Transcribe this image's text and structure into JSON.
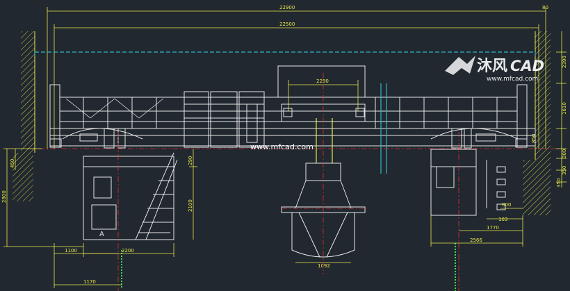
{
  "dimensions": {
    "span_outer": "22900",
    "span_inner": "22500",
    "right_top": "80",
    "trolley_gauge": "2290",
    "right_1": "2390",
    "right_2": "1610",
    "right_3": "850",
    "right_4": "300",
    "right_5": "350",
    "right_6": "350",
    "left_450": "450",
    "left_2800": "2800",
    "mid_290": "290",
    "mid_2100": "2100",
    "bottom_1100": "1100",
    "bottom_2200": "2200",
    "bottom_1170": "1170",
    "right_bottom_1770": "1770",
    "right_bottom_2566": "2566",
    "right_bottom_800": "800",
    "right_bottom_103": "103",
    "grab_1092": "1092"
  },
  "labels": {
    "view_marker": "A"
  },
  "watermarks": {
    "brand_cn": "沐风",
    "brand_en": "CAD",
    "site_url": "www.mfcad.com",
    "center_url": "www.mfcad.com"
  },
  "colors": {
    "background": "#212830",
    "dimension": "#e8e84a",
    "outline": "#e6e6e6",
    "centerline": "#e03030",
    "rail": "#30b8c8",
    "green": "#40e040"
  }
}
